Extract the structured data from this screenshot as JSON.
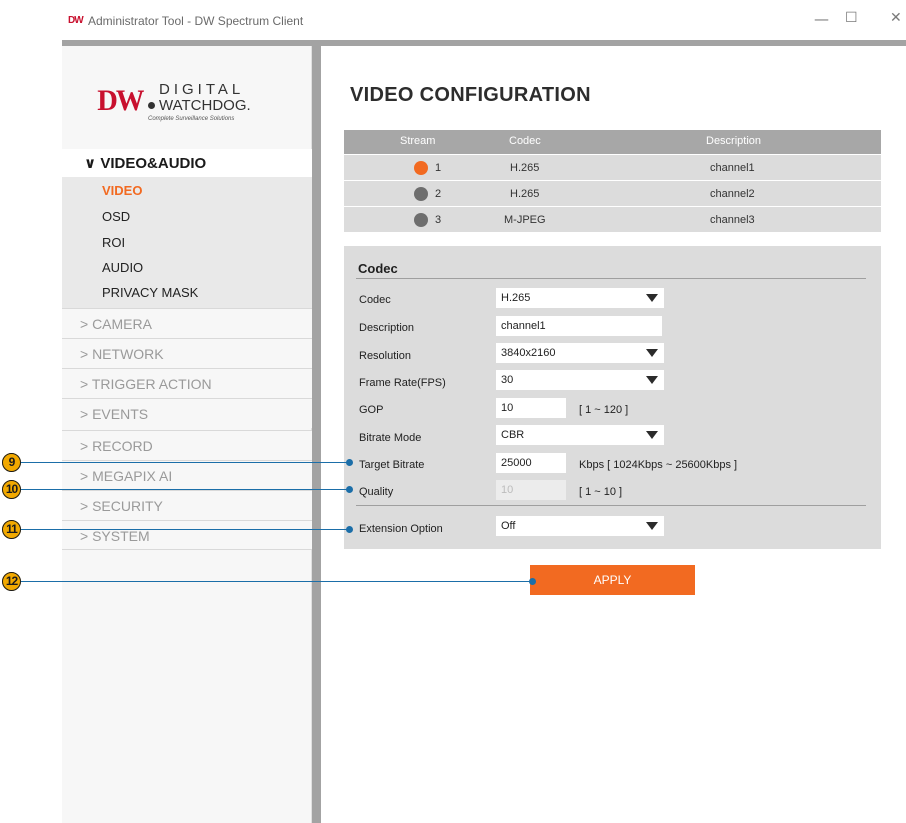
{
  "window": {
    "badge": "DW",
    "title": "Administrator Tool - DW Spectrum Client",
    "minimize": "—",
    "maximize": "☐",
    "close": "✕"
  },
  "logo": {
    "dw": "DW",
    "line1": "DIGITAL",
    "line2": "WATCHDOG.",
    "tagline": "Complete Surveillance Solutions"
  },
  "sidebar": {
    "section": "∨ VIDEO&AUDIO",
    "sub_items": [
      {
        "label": "VIDEO",
        "active": true
      },
      {
        "label": "OSD",
        "active": false
      },
      {
        "label": "ROI",
        "active": false
      },
      {
        "label": "AUDIO",
        "active": false
      },
      {
        "label": "PRIVACY MASK",
        "active": false
      }
    ],
    "nav_items": [
      "> CAMERA",
      "> NETWORK",
      "> TRIGGER ACTION",
      "> EVENTS",
      "> RECORD",
      "> MEGAPIX AI",
      "> SECURITY",
      "> SYSTEM"
    ]
  },
  "page": {
    "title": "VIDEO CONFIGURATION"
  },
  "stream_table": {
    "headers": [
      "Stream",
      "Codec",
      "Description"
    ],
    "rows": [
      {
        "stream": "1",
        "codec": "H.265",
        "description": "channel1",
        "selected": true
      },
      {
        "stream": "2",
        "codec": "H.265",
        "description": "channel2",
        "selected": false
      },
      {
        "stream": "3",
        "codec": "M-JPEG",
        "description": "channel3",
        "selected": false
      }
    ]
  },
  "codec_panel": {
    "title": "Codec",
    "fields": {
      "codec": {
        "label": "Codec",
        "value": "H.265"
      },
      "description": {
        "label": "Description",
        "value": "channel1"
      },
      "resolution": {
        "label": "Resolution",
        "value": "3840x2160"
      },
      "frame_rate": {
        "label": "Frame Rate(FPS)",
        "value": "30"
      },
      "gop": {
        "label": "GOP",
        "value": "10",
        "hint": "[ 1 ~ 120 ]"
      },
      "bitrate_mode": {
        "label": "Bitrate Mode",
        "value": "CBR"
      },
      "target_bitrate": {
        "label": "Target Bitrate",
        "value": "25000",
        "hint": "Kbps [ 1024Kbps ~ 25600Kbps ]"
      },
      "quality": {
        "label": "Quality",
        "value": "10",
        "hint": "[ 1 ~ 10 ]"
      },
      "extension_option": {
        "label": "Extension Option",
        "value": "Off"
      }
    }
  },
  "apply_label": "APPLY",
  "callouts": [
    "9",
    "10",
    "11",
    "12"
  ],
  "colors": {
    "accent": "#f26a21",
    "callout_fill": "#f2a900",
    "callout_line": "#1b6ea8",
    "panel_bg": "#dcdcdc"
  }
}
